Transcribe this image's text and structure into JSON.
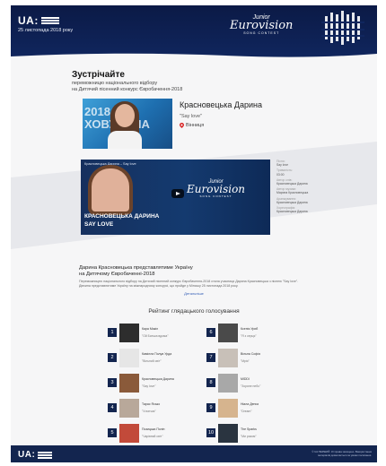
{
  "header": {
    "logo_text": "UA:",
    "date": "25 листопада 2018 року",
    "jesc_junior": "Junior",
    "jesc_eurovision": "Eurovision",
    "jesc_sub": "SONG CONTEST"
  },
  "intro": {
    "title": "Зустрічайте",
    "subtitle_line1": "переможницю національного відбору",
    "subtitle_line2": "на Дитячий пісенний конкурс Євробачення-2018"
  },
  "winner": {
    "photo_text": "2018 ХОВУНИНА",
    "name": "Красновецька Дарина",
    "song": "\"Say love\"",
    "city": "Вінниця"
  },
  "video": {
    "title": "Красновецька Дарина – Say love",
    "caption_line1": "КРАСНОВЕЦЬКА ДАРИНА",
    "caption_line2": "SAY LOVE",
    "logo_junior": "Junior",
    "logo_eurovision": "Eurovision",
    "logo_sub": "SONG CONTEST"
  },
  "details": [
    {
      "label": "Пісня:",
      "value": "Say love"
    },
    {
      "label": "Тривалість:",
      "value": "03:00"
    },
    {
      "label": "Автор слів:",
      "value": "Красновецька Дарина"
    },
    {
      "label": "Автор музики:",
      "value": "Марина Красновецька"
    },
    {
      "label": "Аранжування:",
      "value": "Красновецька Дарина"
    },
    {
      "label": "Хореографія:",
      "value": "Красновецька Дарина"
    }
  ],
  "artist": {
    "title_line1": "Дарина Красновецька представлятиме Україну",
    "title_line2": "на Дитячому Євробаченні-2018",
    "description": "Переможницею національного відбору на Дитячий пісенний конкурс Євробачення-2018 стала учасниця Дарина Красновецька з піснею \"Say love\". Дівчина представлятиме Україну на міжнародному конкурсі, що пройде у Мінську 25 листопада 2018 року.",
    "more": "Детальніше"
  },
  "rating": {
    "title": "Рейтинг глядацького голосування",
    "items": [
      {
        "num": "1",
        "name": "Кара Макіл",
        "song": "\"Ой Батька вдома\"",
        "color": "#2d2d2d"
      },
      {
        "num": "2",
        "name": "Камілла Полуа Урда",
        "song": "\"Вільний світ\"",
        "color": "#e6e6e6"
      },
      {
        "num": "3",
        "name": "Красновецька Дарина",
        "song": "\"Say love\"",
        "color": "#8a5a3a"
      },
      {
        "num": "4",
        "name": "Тарас Ясько",
        "song": "\"Хлопчик\"",
        "color": "#b8a89a"
      },
      {
        "num": "5",
        "name": "Позицька Полін",
        "song": "\"Чарівний світ\"",
        "color": "#c24a3a"
      },
      {
        "num": "6",
        "name": "Ксенія Уриб",
        "song": "\"Я з серця\"",
        "color": "#4a4a4a"
      },
      {
        "num": "7",
        "name": "Вільна Софія",
        "song": "\"Мрія\"",
        "color": "#c8c0b8"
      },
      {
        "num": "8",
        "name": "MIDDI",
        "song": "\"Зоряне небо\"",
        "color": "#a8a8a8"
      },
      {
        "num": "9",
        "name": "Ніала Дениз",
        "song": "\"Dream\"",
        "color": "#d6b48e"
      },
      {
        "num": "10",
        "name": "The Sparks",
        "song": "\"Ми разом\"",
        "color": "#2a3440"
      }
    ]
  },
  "footer": {
    "logo_text": "UA:",
    "copyright": "© UA:ПЕРШИЙ. Усі права захищено. Використання матеріалів дозволяється за умови посилання."
  },
  "colors": {
    "header_bg": "#0b1a46",
    "footer_bg": "#13254f",
    "pin": "#d92b2b",
    "link": "#3a63b8"
  }
}
